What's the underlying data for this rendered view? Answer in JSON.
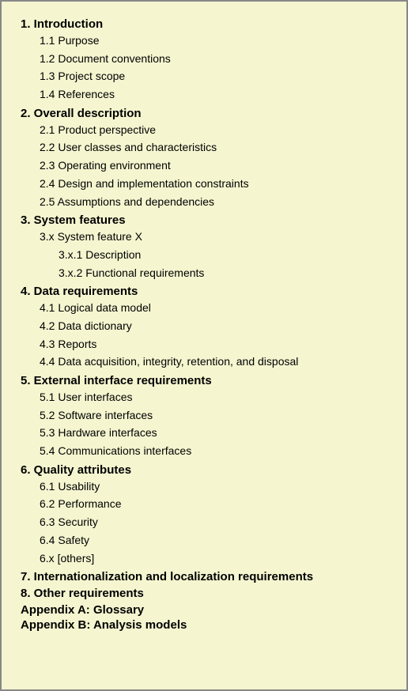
{
  "toc": {
    "sections": [
      {
        "id": "section-1",
        "label": "1. Introduction",
        "subsections": [
          {
            "id": "sub-1-1",
            "label": "1.1 Purpose"
          },
          {
            "id": "sub-1-2",
            "label": "1.2 Document conventions"
          },
          {
            "id": "sub-1-3",
            "label": "1.3 Project scope"
          },
          {
            "id": "sub-1-4",
            "label": "1.4 References"
          }
        ]
      },
      {
        "id": "section-2",
        "label": "2. Overall description",
        "subsections": [
          {
            "id": "sub-2-1",
            "label": "2.1 Product perspective"
          },
          {
            "id": "sub-2-2",
            "label": "2.2 User classes and characteristics"
          },
          {
            "id": "sub-2-3",
            "label": "2.3 Operating environment"
          },
          {
            "id": "sub-2-4",
            "label": "2.4 Design and implementation constraints"
          },
          {
            "id": "sub-2-5",
            "label": "2.5 Assumptions and dependencies"
          }
        ]
      },
      {
        "id": "section-3",
        "label": "3. System features",
        "subsections": [
          {
            "id": "sub-3-x",
            "label": "3.x System feature X",
            "children": [
              {
                "id": "sub-3-x-1",
                "label": "3.x.1 Description"
              },
              {
                "id": "sub-3-x-2",
                "label": "3.x.2 Functional requirements"
              }
            ]
          }
        ]
      },
      {
        "id": "section-4",
        "label": "4. Data requirements",
        "subsections": [
          {
            "id": "sub-4-1",
            "label": "4.1 Logical data model"
          },
          {
            "id": "sub-4-2",
            "label": "4.2 Data dictionary"
          },
          {
            "id": "sub-4-3",
            "label": "4.3 Reports"
          },
          {
            "id": "sub-4-4",
            "label": "4.4 Data acquisition, integrity, retention, and disposal"
          }
        ]
      },
      {
        "id": "section-5",
        "label": "5. External interface requirements",
        "subsections": [
          {
            "id": "sub-5-1",
            "label": "5.1 User interfaces"
          },
          {
            "id": "sub-5-2",
            "label": "5.2 Software interfaces"
          },
          {
            "id": "sub-5-3",
            "label": "5.3 Hardware interfaces"
          },
          {
            "id": "sub-5-4",
            "label": "5.4 Communications interfaces"
          }
        ]
      },
      {
        "id": "section-6",
        "label": "6. Quality attributes",
        "subsections": [
          {
            "id": "sub-6-1",
            "label": "6.1 Usability"
          },
          {
            "id": "sub-6-2",
            "label": "6.2 Performance"
          },
          {
            "id": "sub-6-3",
            "label": "6.3 Security"
          },
          {
            "id": "sub-6-4",
            "label": "6.4 Safety"
          },
          {
            "id": "sub-6-x",
            "label": "6.x [others]"
          }
        ]
      },
      {
        "id": "section-7",
        "label": "7. Internationalization and localization requirements",
        "subsections": []
      },
      {
        "id": "section-8",
        "label": "8. Other requirements",
        "subsections": []
      }
    ],
    "appendices": [
      {
        "id": "appendix-a",
        "label": "Appendix A: Glossary"
      },
      {
        "id": "appendix-b",
        "label": "Appendix B: Analysis models"
      }
    ]
  }
}
